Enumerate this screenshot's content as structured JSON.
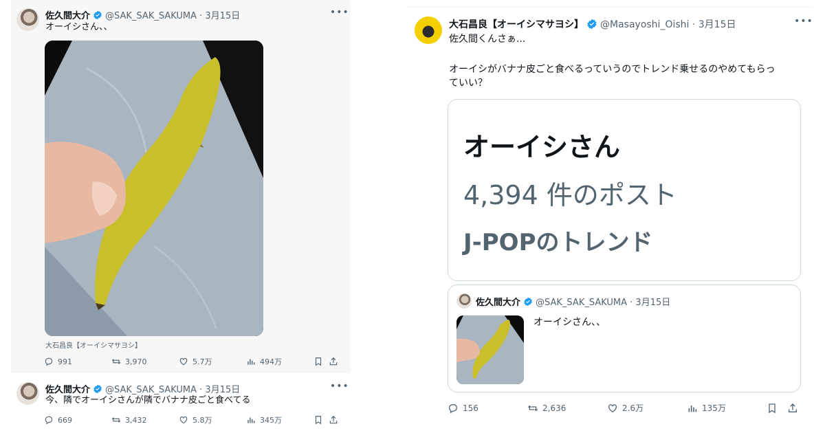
{
  "left_tweets": [
    {
      "name": "佐久間大介",
      "handle": "@SAK_SAK_SAKUMA · 3月15日",
      "text": "オーイシさん、、",
      "caption": "大石昌良【オーイシマサヨシ】",
      "stats": {
        "reply": "991",
        "repost": "3,970",
        "like": "5.7万",
        "views": "494万"
      }
    },
    {
      "name": "佐久間大介",
      "handle": "@SAK_SAK_SAKUMA · 3月15日",
      "text": "今、隣でオーイシさんが隣でバナナ皮ごと食べてる",
      "stats": {
        "reply": "669",
        "repost": "3,432",
        "like": "5.8万",
        "views": "345万"
      }
    }
  ],
  "right_tweet": {
    "name": "大石昌良【オーイシマサヨシ】",
    "handle": "@Masayoshi_Oishi · 3月15日",
    "line1": "佐久間くんさぁ...",
    "line2": "オーイシがバナナ皮ごと食べるっていうのでトレンド乗せるのやめてもらっ",
    "line3": "ていい？",
    "trend": {
      "title": "オーイシさん",
      "count": "4,394 件のポスト",
      "category": "J-POPのトレンド"
    },
    "quote": {
      "name": "佐久間大介",
      "handle": "@SAK_SAK_SAKUMA · 3月15日",
      "text": "オーイシさん、、"
    },
    "stats": {
      "reply": "156",
      "repost": "2,636",
      "like": "2.6万",
      "views": "135万"
    }
  },
  "icons": [
    "more-icon",
    "verified-badge-icon",
    "reply-icon",
    "repost-icon",
    "like-icon",
    "views-icon",
    "bookmark-icon",
    "share-icon"
  ],
  "colors": {
    "verified": "#1d9bf0",
    "secondary_text": "#536471",
    "banana": "#c9bf2a"
  }
}
